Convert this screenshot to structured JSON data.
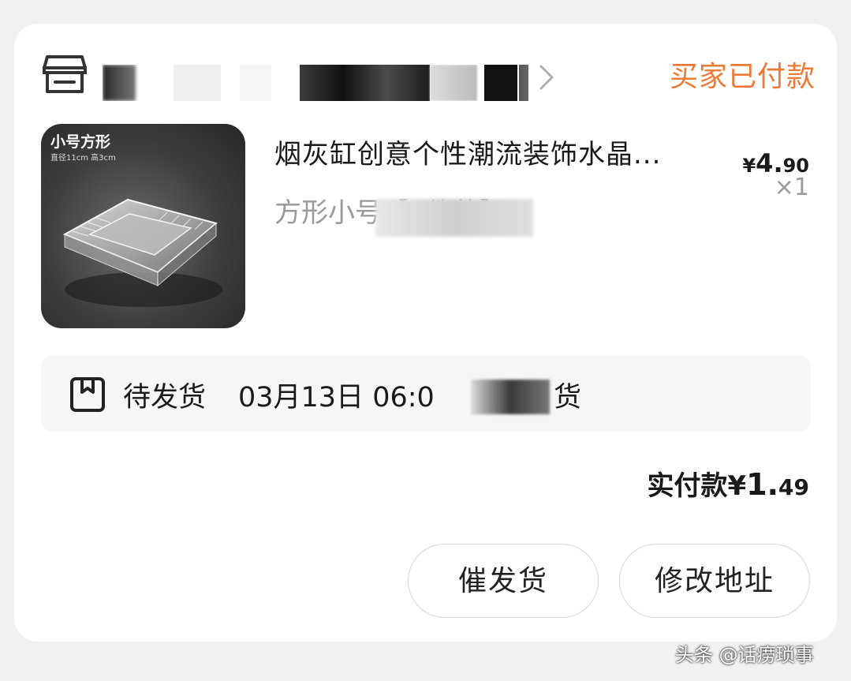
{
  "store": {
    "name_visible": "",
    "status": "买家已付款"
  },
  "product": {
    "thumb_title": "小号方形",
    "thumb_subtitle": "直径11cm 高3cm",
    "title": "烟灰缸创意个性潮流装饰水晶...",
    "variant": "方形小号【1件",
    "variant_tail": "装】",
    "price_yen": "¥",
    "price_int": "4.",
    "price_dec": "90",
    "quantity": "×1"
  },
  "shipping": {
    "status": "待发货",
    "time": "03月13日 06:0",
    "tail": "货"
  },
  "payment": {
    "label": "实付款",
    "yen": "¥",
    "int": "1.",
    "dec": "49"
  },
  "actions": {
    "urge_label": "催发货",
    "address_label": "修改地址"
  },
  "watermark": "头条 @话痨琐事",
  "colors": {
    "status_accent": "#ee7a36",
    "card_bg": "#ffffff",
    "page_bg": "#f1f1f1"
  },
  "icons": [
    "store-icon",
    "chevron-right-icon",
    "package-icon"
  ]
}
